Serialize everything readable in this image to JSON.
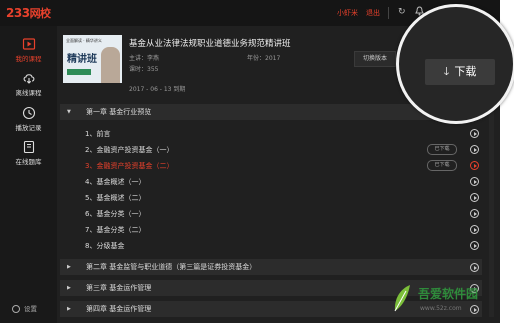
{
  "app": {
    "logo_main": "233",
    "logo_sub": "网校"
  },
  "topbar": {
    "username": "小虾米",
    "logout": "退出",
    "refresh_icon": "refresh-icon",
    "bell_icon": "bell-icon"
  },
  "sidebar": {
    "items": [
      {
        "label": "我的课程",
        "icon": "play-square-icon",
        "active": true
      },
      {
        "label": "离线课程",
        "icon": "cloud-download-icon",
        "active": false
      },
      {
        "label": "播放记录",
        "icon": "clock-icon",
        "active": false
      },
      {
        "label": "在线题库",
        "icon": "book-icon",
        "active": false
      }
    ],
    "settings": "设置"
  },
  "course": {
    "cover_line": "全面解读 · 精华讲义",
    "cover_title": "精讲班",
    "title": "基金从业法律法规职业道德业务规范精讲班",
    "teacher": "主讲：李燕",
    "year": "年份：2017",
    "hours": "课时：355",
    "expire": "2017 - 06 - 13 到期",
    "switch_version": "切换版本",
    "download": "下载"
  },
  "chapters": [
    {
      "title": "第一章 基金行业预览",
      "expanded": true
    },
    {
      "title": "第二章 基金监管与职业道德（第三篇是证券投资基金）",
      "expanded": false
    },
    {
      "title": "第三章 基金运作管理",
      "expanded": false
    },
    {
      "title": "第四章 基金运作管理",
      "expanded": false
    }
  ],
  "lessons": [
    {
      "label": "1、前言",
      "downloaded": false,
      "active": false
    },
    {
      "label": "2、金融资产投资基金（一）",
      "downloaded": true,
      "active": false
    },
    {
      "label": "3、金融资产投资基金（二）",
      "downloaded": true,
      "active": true
    },
    {
      "label": "4、基金概述（一）",
      "downloaded": false,
      "active": false
    },
    {
      "label": "5、基金概述（二）",
      "downloaded": false,
      "active": false
    },
    {
      "label": "6、基金分类（一）",
      "downloaded": false,
      "active": false
    },
    {
      "label": "7、基金分类（二）",
      "downloaded": false,
      "active": false
    },
    {
      "label": "8、分级基金",
      "downloaded": false,
      "active": false
    }
  ],
  "badges": {
    "downloaded": "已下载"
  },
  "watermark": {
    "title": "吾爱软件园",
    "url": "www.52z.com"
  },
  "colors": {
    "accent": "#e8412c",
    "background": "#202020",
    "sidebar": "#191919"
  }
}
